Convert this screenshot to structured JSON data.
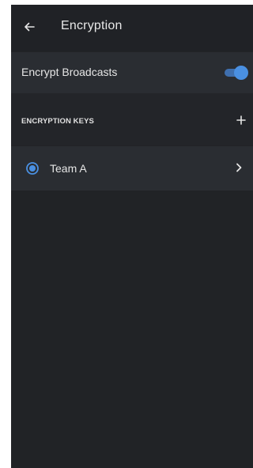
{
  "header": {
    "title": "Encryption",
    "back_icon": "back-arrow-icon"
  },
  "settings": {
    "encrypt_broadcasts": {
      "label": "Encrypt Broadcasts",
      "enabled": true
    }
  },
  "encryption_keys": {
    "section_title": "ENCRYPTION KEYS",
    "add_icon": "plus-icon",
    "items": [
      {
        "label": "Team A",
        "selected": true,
        "icon": "chevron-right-icon"
      }
    ]
  },
  "colors": {
    "background": "#212326",
    "row": "#2a2d32",
    "accent": "#4a90e2",
    "text": "#e6e6e6"
  }
}
